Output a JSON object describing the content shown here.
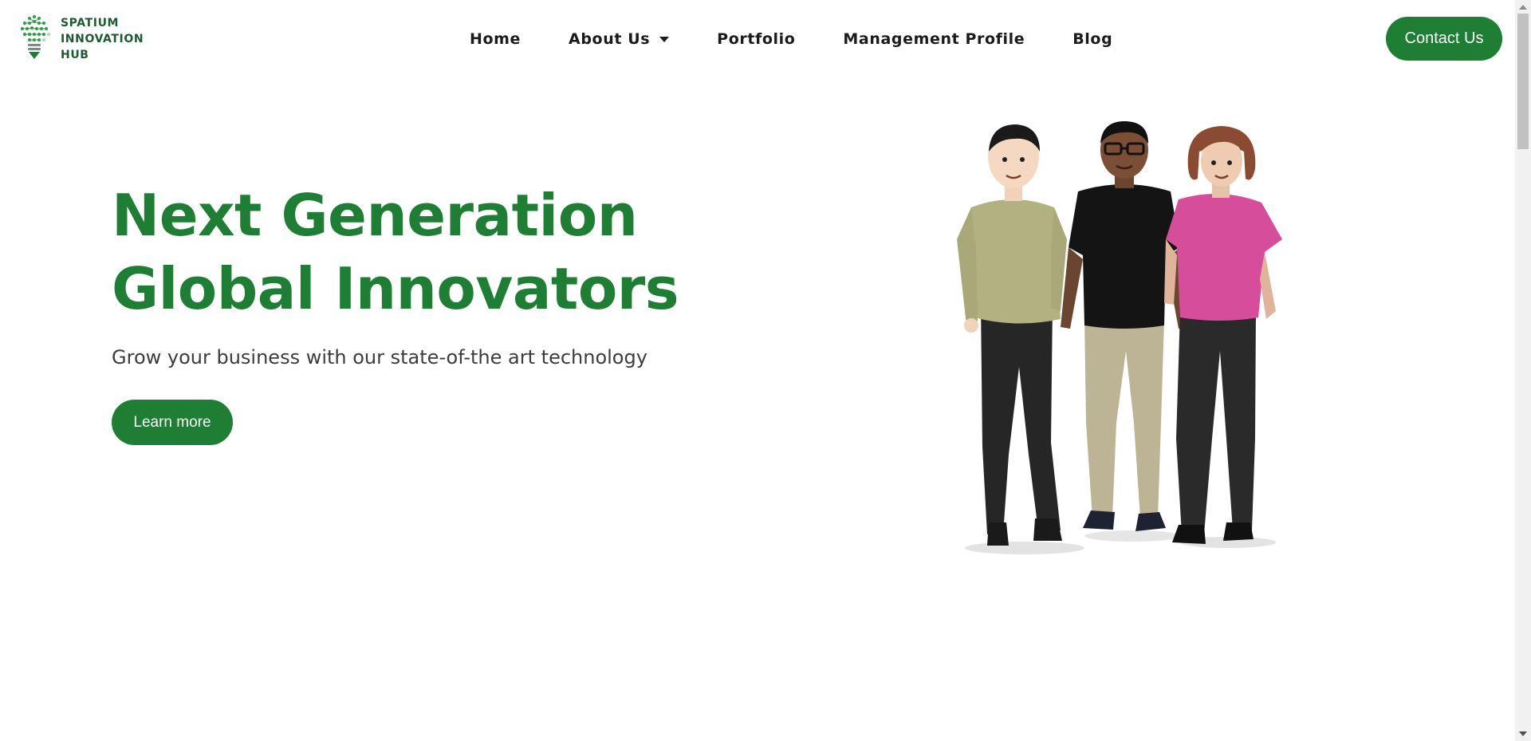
{
  "header": {
    "logo": {
      "lines": [
        "SPATIUM",
        "INNOVATION",
        "HUB"
      ]
    },
    "nav": [
      {
        "label": "Home"
      },
      {
        "label": "About Us",
        "has_dropdown": true
      },
      {
        "label": "Portfolio"
      },
      {
        "label": "Management Profile"
      },
      {
        "label": "Blog"
      }
    ],
    "contact_label": "Contact Us"
  },
  "hero": {
    "title": "Next Generation Global Innovators",
    "subtitle": "Grow your business with our state-of-the art technology",
    "cta_label": "Learn more"
  },
  "theme": {
    "brand_green": "#1e7e34",
    "logo_green": "#1d5a2f",
    "text_dark": "#1b1b1b",
    "text_muted": "#3c3c3c"
  },
  "icons": {
    "logo": "lightbulb-circuit-icon",
    "dropdown": "caret-down-icon",
    "hero_image": "three-people-illustration"
  }
}
